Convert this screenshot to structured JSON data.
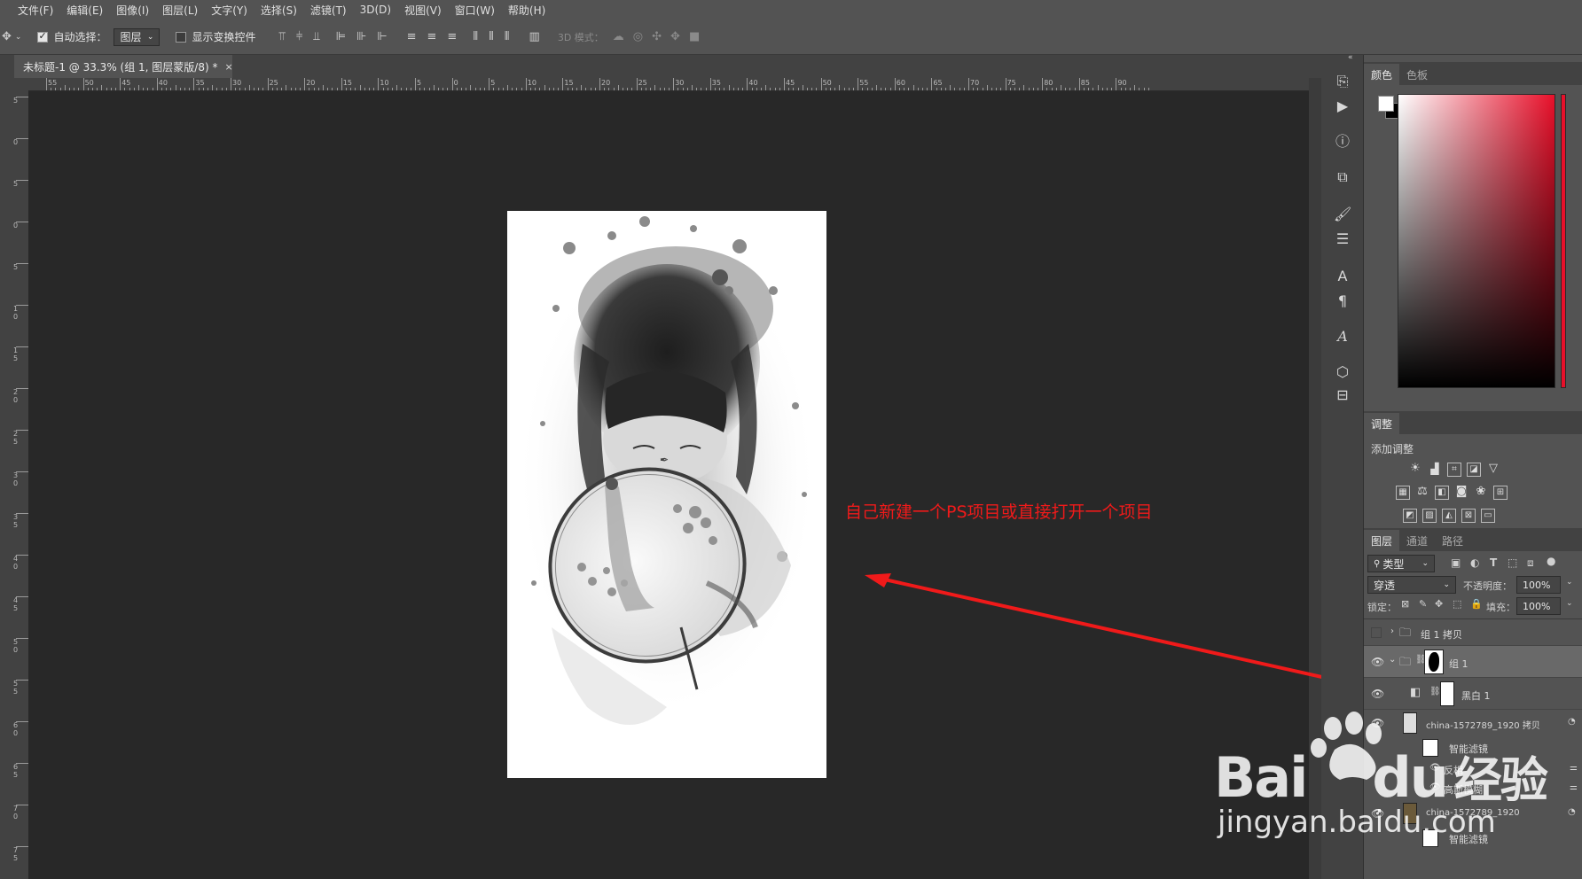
{
  "menu": [
    "文件(F)",
    "编辑(E)",
    "图像(I)",
    "图层(L)",
    "文字(Y)",
    "选择(S)",
    "滤镜(T)",
    "3D(D)",
    "视图(V)",
    "窗口(W)",
    "帮助(H)"
  ],
  "options": {
    "auto_select_label": "自动选择：",
    "auto_select_value": "图层",
    "show_transform_label": "显示变换控件",
    "mode_3d_label": "3D 模式："
  },
  "document_tab": {
    "title": "未标题-1 @ 33.3% (组 1, 图层蒙版/8) *",
    "close": "×"
  },
  "ruler_h": [
    "55",
    "50",
    "45",
    "40",
    "35",
    "30",
    "25",
    "20",
    "15",
    "10",
    "5",
    "0",
    "5",
    "10",
    "15",
    "20",
    "25",
    "30",
    "35",
    "40",
    "45",
    "50",
    "55",
    "60",
    "65",
    "70",
    "75",
    "80",
    "85",
    "90"
  ],
  "ruler_v": [
    "5",
    "0",
    "5",
    "0",
    "5",
    "1 0",
    "1 5",
    "2 0",
    "2 5",
    "3 0",
    "3 5",
    "4 0",
    "4 5",
    "5 0",
    "5 5",
    "6 0",
    "6 5",
    "7 0",
    "7 5"
  ],
  "annotation": "自己新建一个PS项目或直接打开一个项目",
  "color_panel": {
    "tab_color": "颜色",
    "tab_swatches": "色板",
    "foreground": "#ffffff",
    "background": "#000000",
    "hue_color": "#e8102a"
  },
  "adjustments_panel": {
    "tab": "调整",
    "add_label": "添加调整"
  },
  "layers_panel": {
    "tabs": [
      "图层",
      "通道",
      "路径"
    ],
    "filter_label": "类型",
    "blend_mode": "穿透",
    "opacity_label": "不透明度：",
    "opacity_value": "100%",
    "lock_label": "锁定：",
    "fill_label": "填充：",
    "fill_value": "100%",
    "layers": [
      {
        "name": "组 1 拷贝",
        "visible": false,
        "type": "group"
      },
      {
        "name": "组 1",
        "visible": true,
        "type": "group-mask"
      },
      {
        "name": "黑白 1",
        "visible": true,
        "type": "adjustment"
      },
      {
        "name": "china-1572789_1920 拷贝",
        "visible": true,
        "type": "smart"
      },
      {
        "name": "智能滤镜",
        "visible": true,
        "type": "filter"
      },
      {
        "name": "反相",
        "visible": true,
        "type": "filter-item"
      },
      {
        "name": "高斯模糊",
        "visible": true,
        "type": "filter-item"
      },
      {
        "name": "china-1572789_1920",
        "visible": true,
        "type": "smart"
      },
      {
        "name": "智能滤镜",
        "visible": true,
        "type": "filter"
      }
    ]
  },
  "watermark": {
    "brand": "Bai",
    "brand_du": "du",
    "brand_cn": "经验",
    "url": "jingyan.baidu.com"
  }
}
